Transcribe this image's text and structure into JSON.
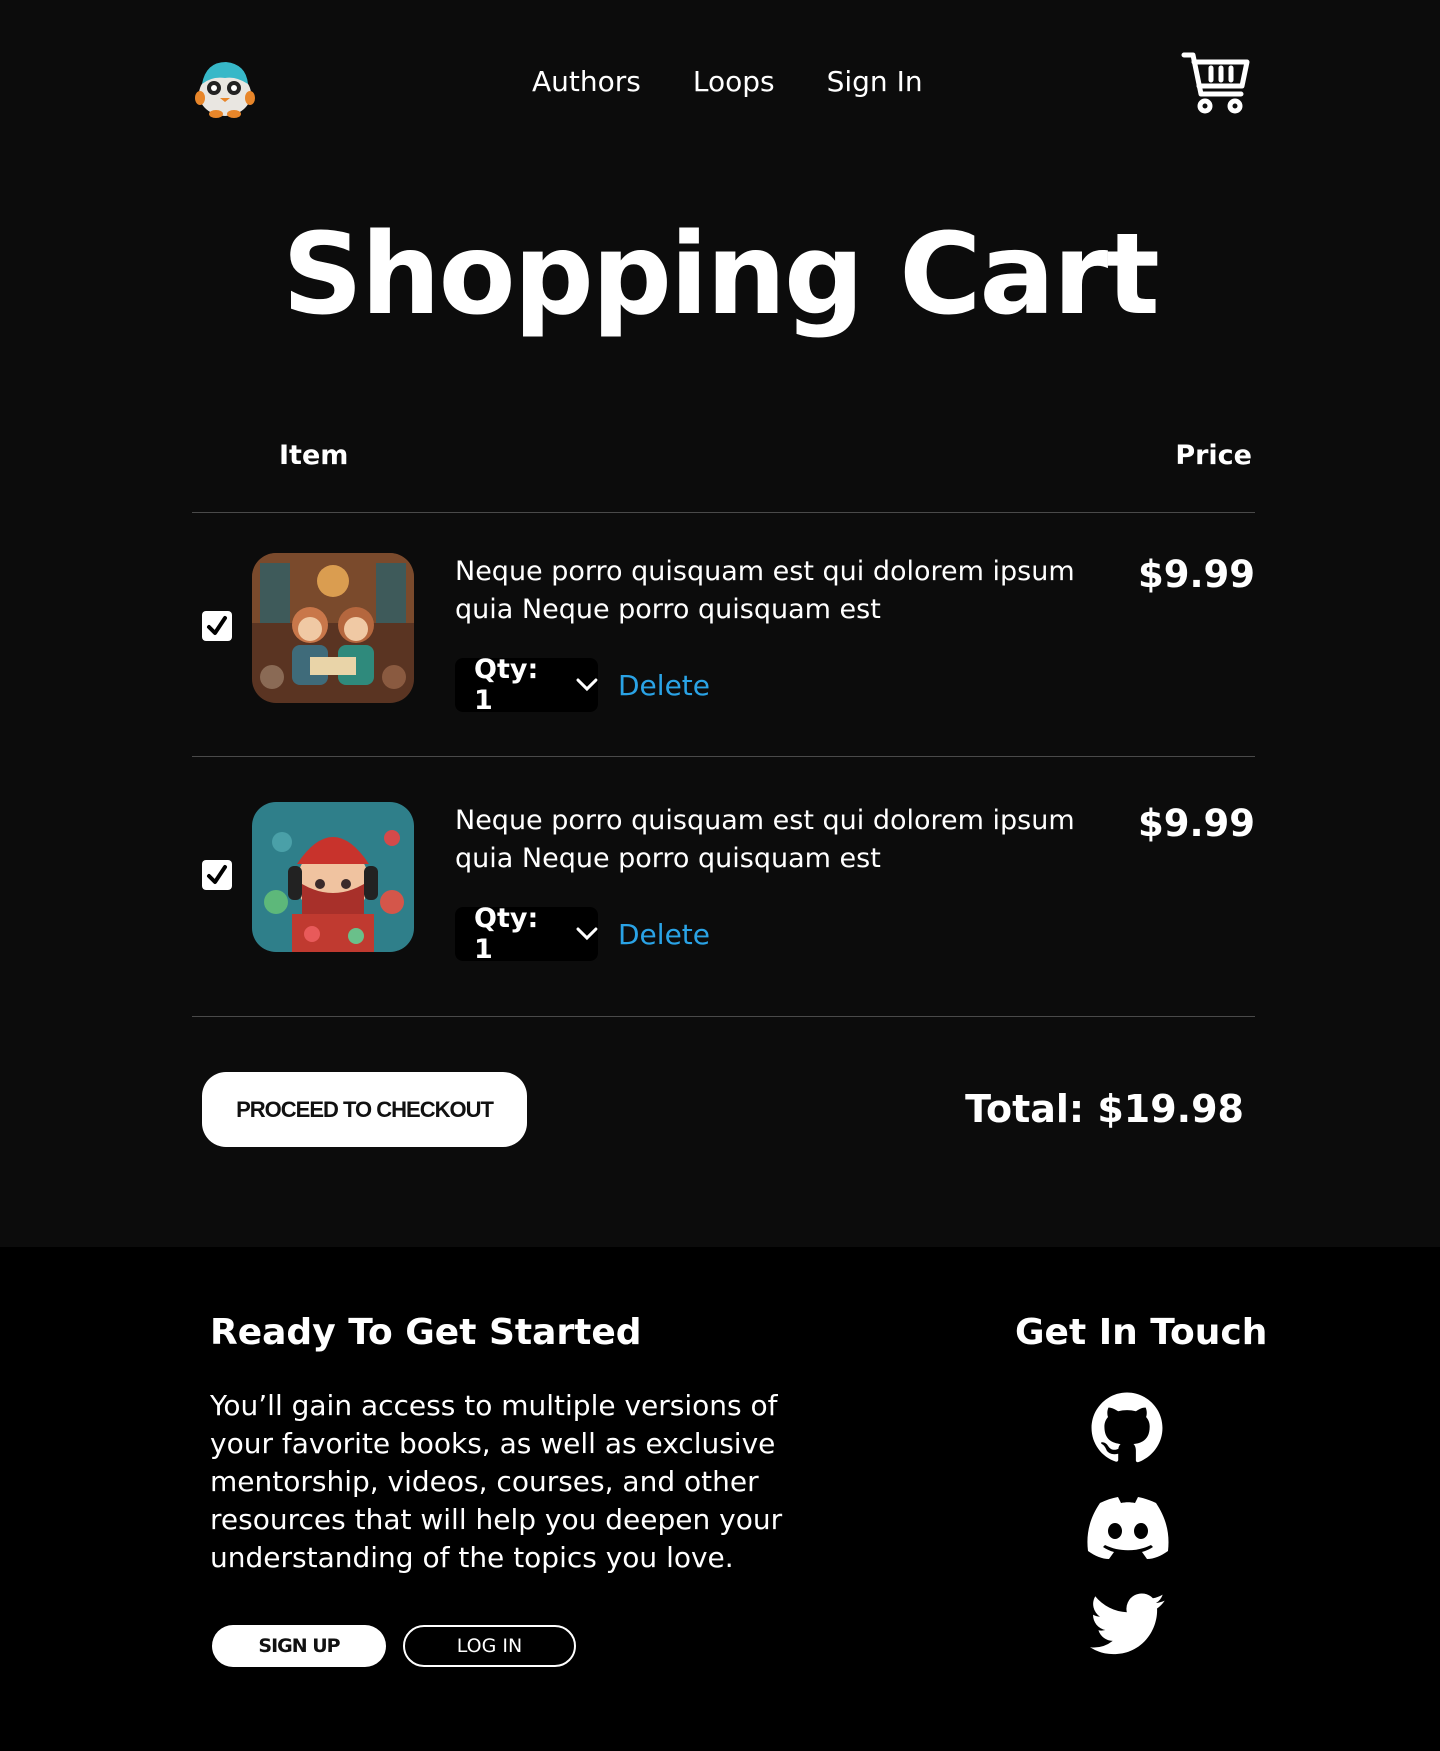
{
  "header": {
    "nav": [
      "Authors",
      "Loops",
      "Sign In"
    ]
  },
  "page_title": "Shopping Cart",
  "table": {
    "col_item": "Item",
    "col_price": "Price"
  },
  "cart": {
    "items": [
      {
        "title": "Neque porro quisquam est qui dolorem ipsum quia Neque porro quisquam est",
        "qty_label": "Qty: 1",
        "delete_label": "Delete",
        "price": "$9.99",
        "checked": true,
        "thumb": "children-reading-library"
      },
      {
        "title": "Neque porro quisquam est qui dolorem ipsum quia Neque porro quisquam est",
        "qty_label": "Qty: 1",
        "delete_label": "Delete",
        "price": "$9.99",
        "checked": true,
        "thumb": "girl-headphones-red-hat"
      }
    ],
    "checkout_label": "PROCEED TO CHECKOUT",
    "total": "Total: $19.98"
  },
  "footer": {
    "title": "Ready To Get Started",
    "text": "You’ll gain access to multiple versions of your favorite books, as well as exclusive mentorship, videos, courses, and other resources that will help you deepen your understanding of the topics you love.",
    "signup_label": "SIGN UP",
    "login_label": "LOG IN",
    "touch_title": "Get In Touch",
    "social": [
      "github-icon",
      "discord-icon",
      "twitter-icon"
    ]
  },
  "colors": {
    "background": "#0c0c0c",
    "footer_bg": "#000000",
    "link": "#2aa3e6",
    "text": "#ffffff"
  }
}
